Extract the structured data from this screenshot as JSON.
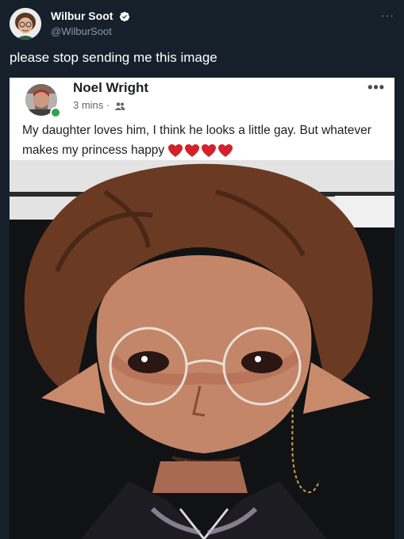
{
  "tweet": {
    "display_name": "Wilbur Soot",
    "handle": "@WilburSoot",
    "text": "please stop sending me this image",
    "more_icon": "more-dots-icon",
    "verified_icon": "verified-badge-icon"
  },
  "fb_post": {
    "author": "Noel Wright",
    "meta": "3 mins ·",
    "audience_icon": "friends-icon",
    "text": "My daughter loves him, I think he looks a little gay. But whatever makes my princess happy",
    "hearts_icon": "heart-emoji-icon"
  },
  "colors": {
    "background": "#15202b",
    "secondary_text": "#8b98a5",
    "verified": "#ffffff",
    "fb_online": "#31a24c"
  }
}
